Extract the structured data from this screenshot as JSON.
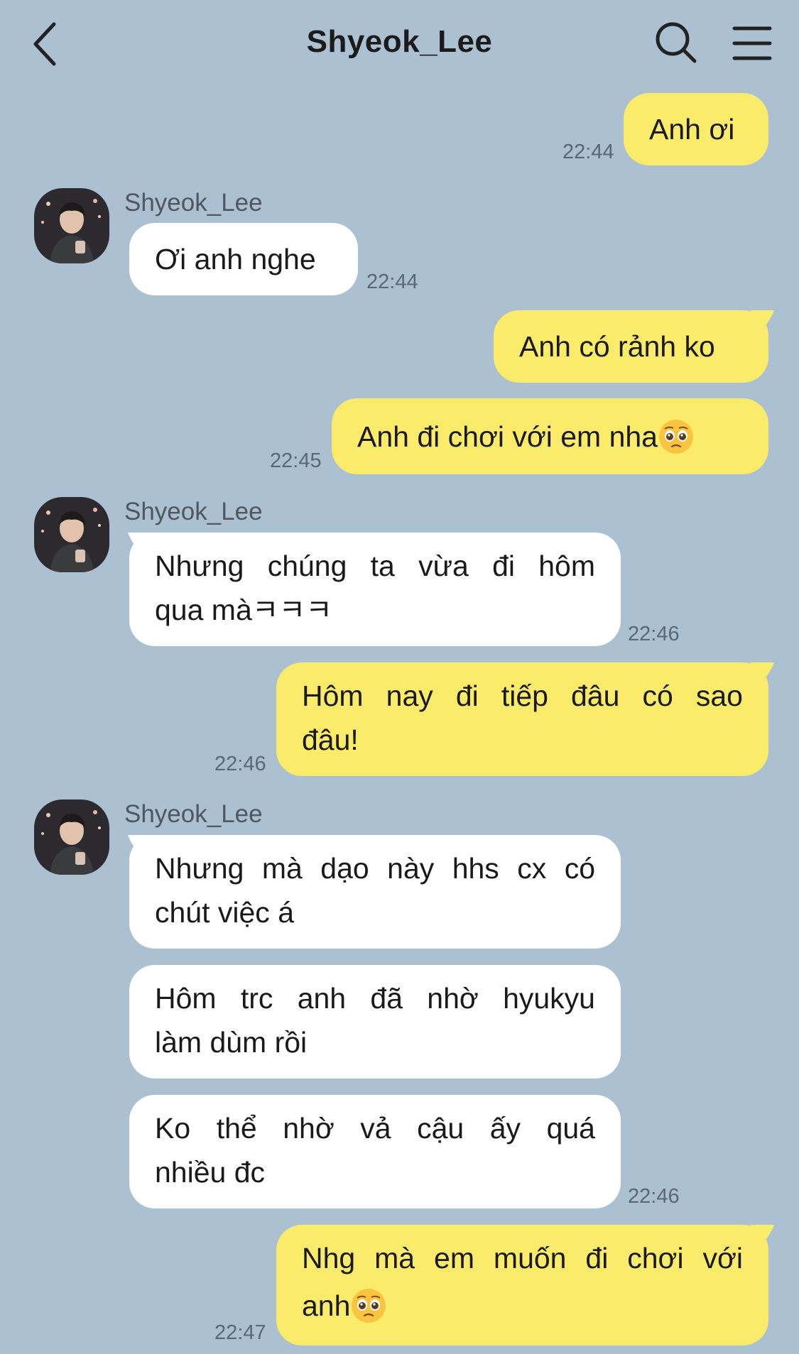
{
  "header": {
    "title": "Shyeok_Lee",
    "back_icon": "chevron-left-icon",
    "search_icon": "search-icon",
    "menu_icon": "hamburger-menu-icon"
  },
  "colors": {
    "background": "#abc1d1",
    "my_bubble": "#fbeb6b",
    "their_bubble": "#ffffff"
  },
  "messages": [
    {
      "from": "me",
      "text": "Anh ơi",
      "time": "22:44"
    },
    {
      "from": "them",
      "sender": "Shyeok_Lee",
      "text": "Ơi anh nghe",
      "time": "22:44"
    },
    {
      "from": "me",
      "text": "Anh có rảnh ko"
    },
    {
      "from": "me",
      "text": "Anh đi chơi với em nha",
      "emoji": "pleading-face",
      "time": "22:45"
    },
    {
      "from": "them",
      "sender": "Shyeok_Lee",
      "lines": [
        "Nhưng chúng ta vừa đi hôm",
        "qua màㅋㅋㅋ"
      ],
      "time": "22:46"
    },
    {
      "from": "me",
      "lines": [
        "Hôm nay đi tiếp đâu có sao",
        "đâu!"
      ],
      "time": "22:46"
    },
    {
      "from": "them",
      "sender": "Shyeok_Lee",
      "lines": [
        "Nhưng mà dạo này hhs cx có",
        "chút việc á"
      ]
    },
    {
      "from": "them",
      "lines": [
        "Hôm trc anh đã nhờ hyukyu",
        "làm dùm rồi"
      ]
    },
    {
      "from": "them",
      "lines": [
        "Ko thể nhờ vả cậu ấy quá",
        "nhiều đc"
      ],
      "time": "22:46"
    },
    {
      "from": "me",
      "lines": [
        "Nhg mà em muốn đi chơi với",
        "anh"
      ],
      "emoji": "pleading-face",
      "time": "22:47"
    }
  ]
}
